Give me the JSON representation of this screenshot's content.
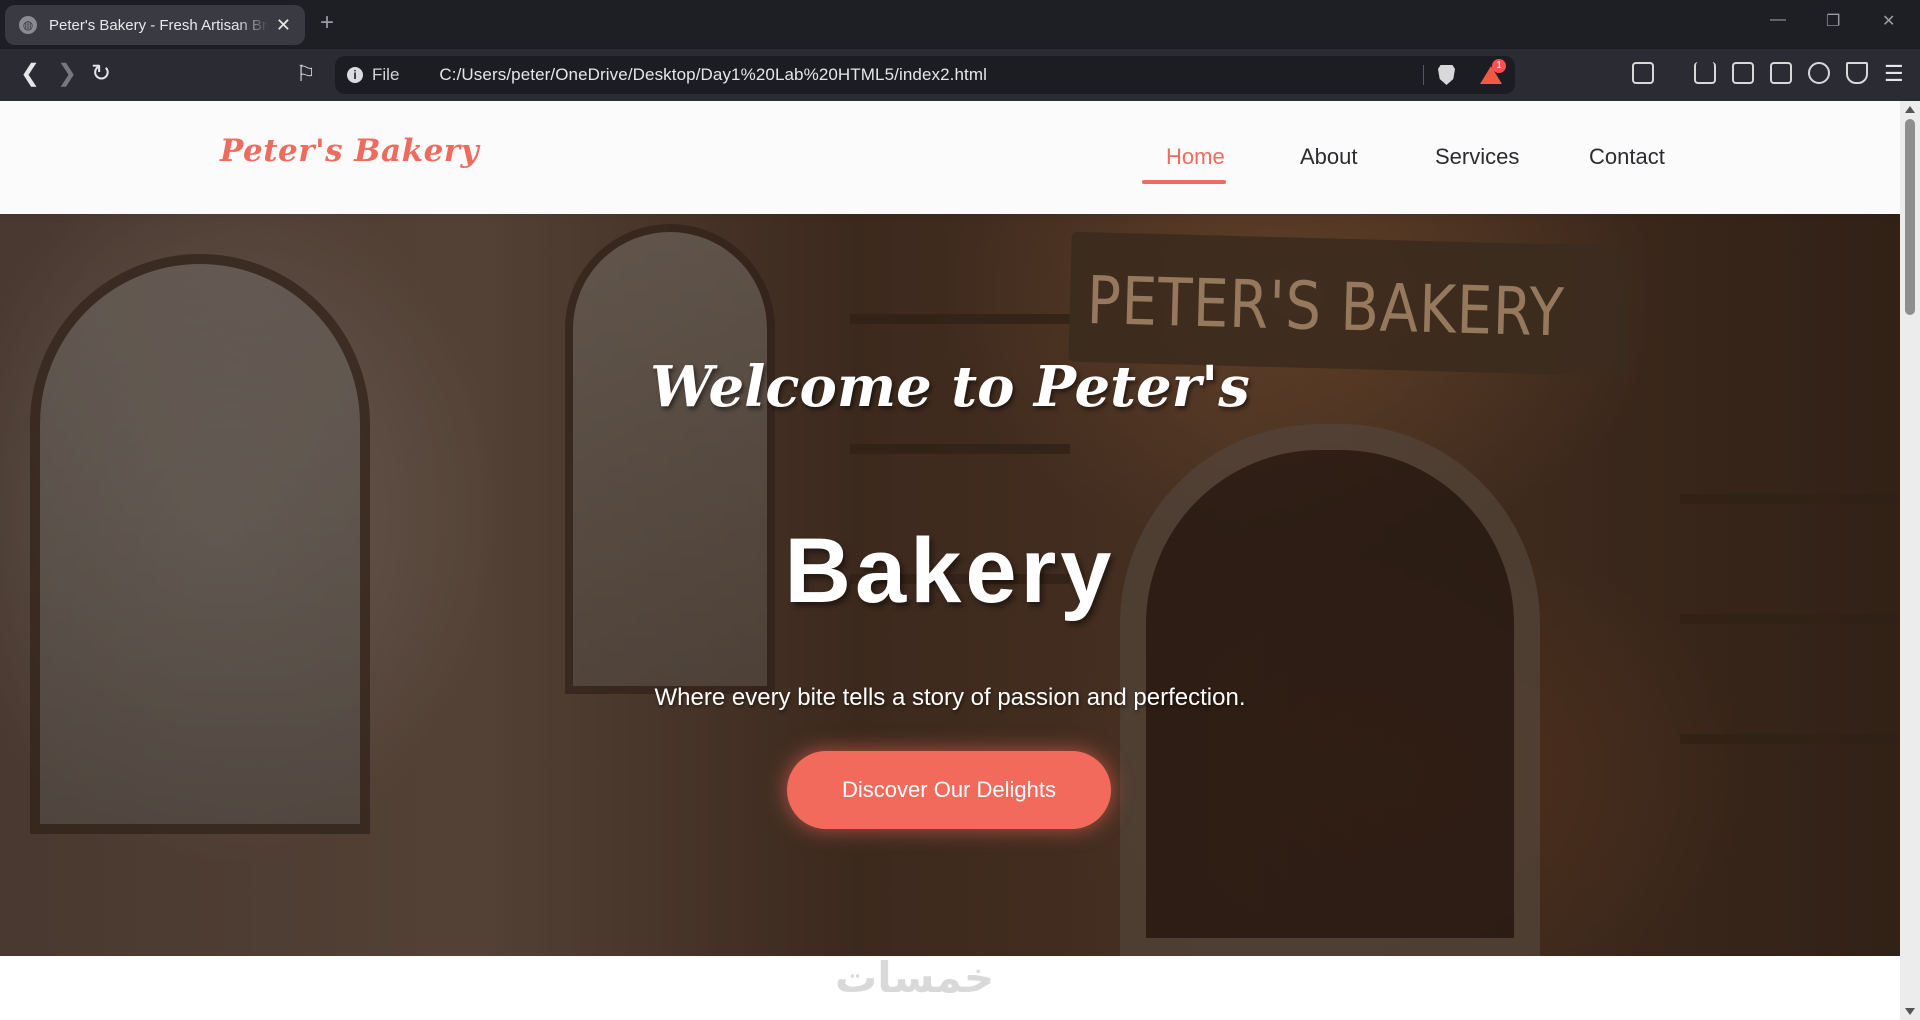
{
  "browser": {
    "tab_title": "Peter's Bakery - Fresh Artisan Bre",
    "new_tab": "+",
    "url_scheme": "File",
    "url": "C:/Users/peter/OneDrive/Desktop/Day1%20Lab%20HTML5/index2.html",
    "rewards_badge": "1",
    "controls": {
      "minimize": "—",
      "restore": "❐",
      "close": "✕"
    },
    "nav": {
      "back": "❮",
      "forward": "❯",
      "reload": "↻",
      "tab_close": "✕"
    }
  },
  "site": {
    "logo": "Peter's Bakery",
    "nav": {
      "home": "Home",
      "about": "About",
      "services": "Services",
      "contact": "Contact"
    },
    "hero": {
      "sign": "PETER'S BAKERY",
      "subtitle": "Welcome to Peter's",
      "title": "Bakery",
      "description": "Where every bite tells a story of passion and perfection.",
      "cta": "Discover Our Delights"
    },
    "watermark": "خمسات"
  },
  "colors": {
    "accent": "#ef6b5e",
    "cta": "#f26a5c"
  }
}
